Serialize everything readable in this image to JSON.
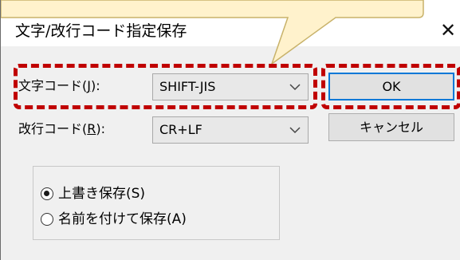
{
  "window": {
    "title": "文字/改行コード指定保存",
    "close_glyph": "✕"
  },
  "form": {
    "charset": {
      "label_prefix": "文字コード(",
      "label_key": "J",
      "label_suffix": "):",
      "value": "SHIFT-JIS"
    },
    "newline": {
      "label_prefix": "改行コード(",
      "label_key": "R",
      "label_suffix": "):",
      "value": "CR+LF"
    }
  },
  "buttons": {
    "ok": "OK",
    "cancel": "キャンセル"
  },
  "save_mode": {
    "options": [
      {
        "label": "上書き保存(S)",
        "checked": true
      },
      {
        "label": "名前を付けて保存(A)",
        "checked": false
      }
    ]
  },
  "annotations": {
    "highlight_color": "#c00000",
    "callout_fill": "#fff2cc",
    "callout_stroke": "#c8b26a"
  }
}
